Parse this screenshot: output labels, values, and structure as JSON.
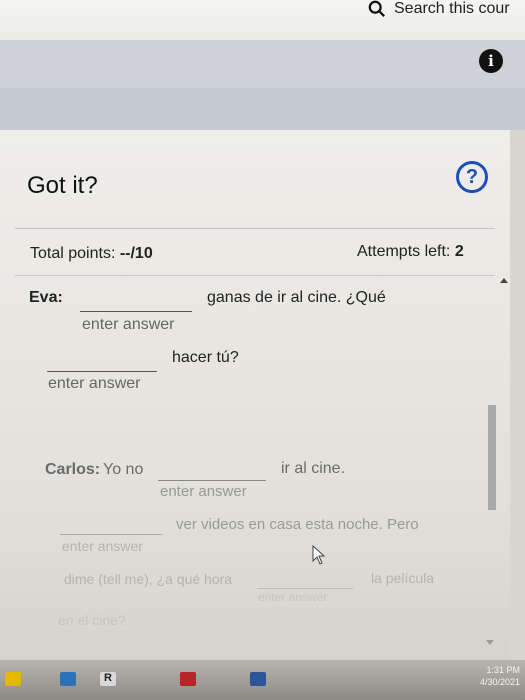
{
  "header": {
    "search_label": "Search this cour"
  },
  "panel": {
    "title": "Got it?",
    "points_label": "Total points: ",
    "points_value": "--/10",
    "attempts_label": "Attempts left: ",
    "attempts_value": "2"
  },
  "exercise": {
    "eva_label": "Eva:",
    "eva_line1": "ganas de ir al cine. ¿Qué",
    "eva_line2": "hacer tú?",
    "carlos_label": "Carlos:",
    "carlos_part1": "Yo no",
    "carlos_part2": "ir al cine.",
    "carlos_line2": "ver videos en casa esta noche. Pero",
    "carlos_line3a": "dime (tell me), ¿a qué hora",
    "carlos_line3b": "la película",
    "carlos_line4": "en el cine?",
    "placeholder": "enter answer"
  },
  "taskbar": {
    "time": "1:31 PM",
    "date": "4/30/2021"
  },
  "colors": {
    "help_ring": "#1a4fb8",
    "info_bg": "#111111"
  },
  "icons": [
    "search-icon",
    "info-icon",
    "help-icon",
    "cursor-icon",
    "lock-icon",
    "mail-icon",
    "r-app-icon",
    "word-icon"
  ]
}
